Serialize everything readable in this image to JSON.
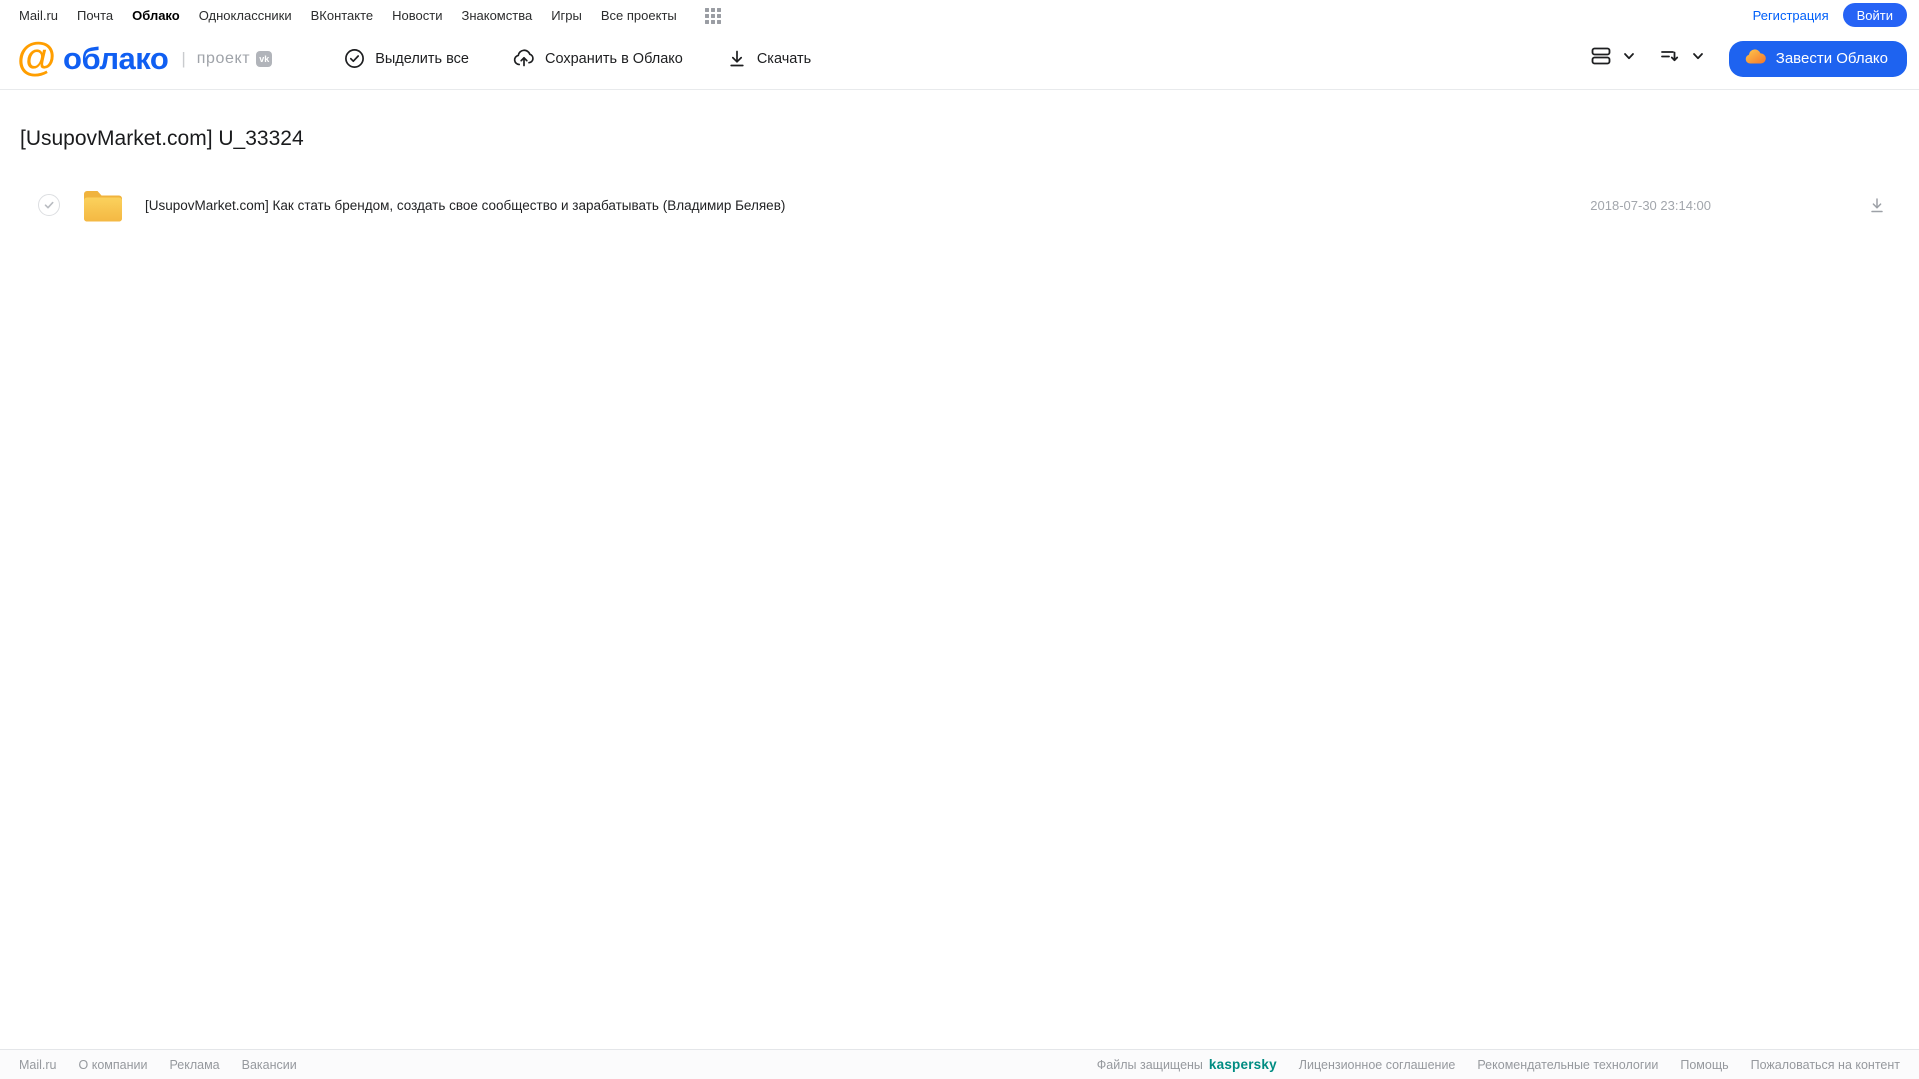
{
  "topnav": {
    "links": [
      "Mail.ru",
      "Почта",
      "Облако",
      "Одноклассники",
      "ВКонтакте",
      "Новости",
      "Знакомства",
      "Игры",
      "Все проекты"
    ],
    "active_link": "Облако",
    "register_label": "Регистрация",
    "login_label": "Войти"
  },
  "header": {
    "logo_at": "@",
    "logo_text": "облако",
    "project_divider": "|",
    "project_label": "проект",
    "vk_badge": "vk",
    "toolbar": {
      "select_all": "Выделить все",
      "save_to_cloud": "Сохранить в Облако",
      "download": "Скачать"
    },
    "cta_label": "Завести Облако"
  },
  "page": {
    "title": "[UsupovMarket.com] U_33324"
  },
  "files": [
    {
      "type": "folder",
      "name": "[UsupovMarket.com] Как стать брендом, создать свое сообщество и зарабатывать (Владимир Беляев)",
      "date": "2018-07-30 23:14:00"
    }
  ],
  "footer": {
    "links_left": [
      "Mail.ru",
      "О компании",
      "Реклама",
      "Вакансии"
    ],
    "protected_text": "Файлы защищены",
    "kaspersky": "kaspersky",
    "links_right": [
      "Лицензионное соглашение",
      "Рекомендательные технологии",
      "Помощь",
      "Пожаловаться на контент"
    ]
  },
  "colors": {
    "primary_blue": "#005ff9",
    "logo_orange": "#ff9e00",
    "folder_yellow": "#f6bc45",
    "kaspersky_teal": "#008c82"
  }
}
